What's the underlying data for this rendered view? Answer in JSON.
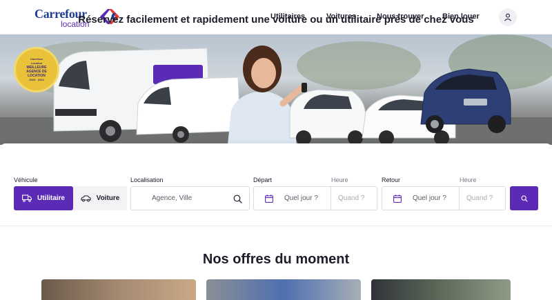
{
  "header": {
    "logo_brand": "Carrefour",
    "logo_sub": "location",
    "nav": [
      "Utilitaires",
      "Voitures",
      "Nous trouver",
      "Bien louer"
    ]
  },
  "hero": {
    "badge_lines": [
      "Carrefour",
      "Location",
      "MEILLEURE",
      "AGENCE DE",
      "LOCATION",
      "2023 · 2024"
    ]
  },
  "search": {
    "title": "Réservez facilement et rapidement une voiture ou un utilitaire près de chez vous",
    "vehicle_label": "Véhicule",
    "vehicle_options": [
      "Utilitaire",
      "Voiture"
    ],
    "location_label": "Localisation",
    "location_placeholder": "Agence, Ville",
    "departure_label": "Départ",
    "return_label": "Retour",
    "hour_label": "Heure",
    "date_placeholder": "Quel jour ?",
    "time_placeholder": "Quand ?"
  },
  "offers": {
    "title": "Nos offres du moment"
  },
  "colors": {
    "accent": "#5b2bb5",
    "brand_blue": "#1f3e92"
  }
}
